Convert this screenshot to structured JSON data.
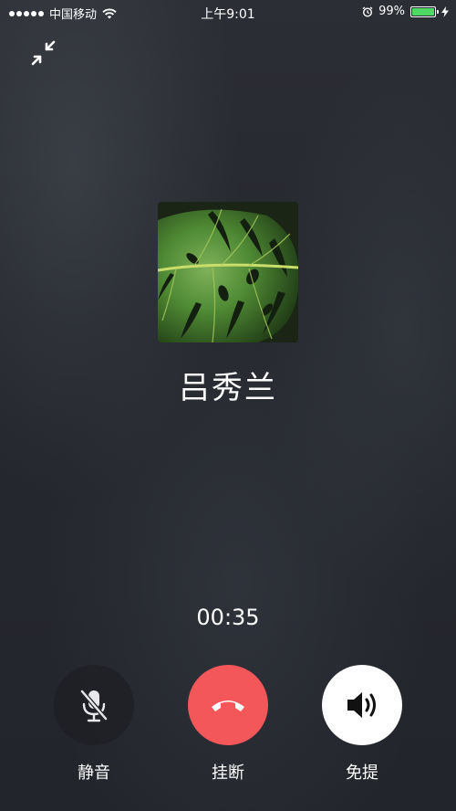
{
  "status_bar": {
    "carrier": "中国移动",
    "time": "上午9:01",
    "battery": "99%",
    "battery_level": 0.99
  },
  "call": {
    "caller_name": "吕秀兰",
    "duration": "00:35"
  },
  "controls": {
    "mute_label": "静音",
    "hangup_label": "挂断",
    "speaker_label": "免提"
  },
  "icons": {
    "minimize": "minimize-icon",
    "mute": "mic-off-icon",
    "hangup": "phone-hangup-icon",
    "speaker": "speaker-icon"
  },
  "colors": {
    "hangup": "#f4575a",
    "battery": "#4cd964"
  }
}
